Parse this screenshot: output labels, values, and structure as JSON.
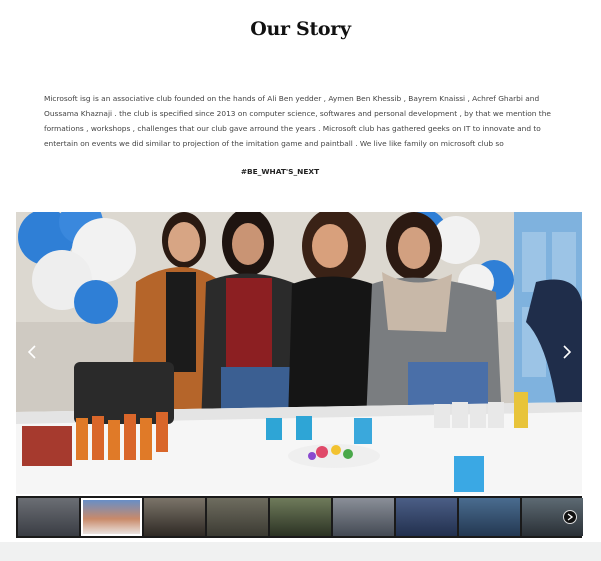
{
  "page": {
    "title": "Our Story",
    "story": "Microsoft isg is an associative club founded on the hands of Ali Ben yedder , Aymen Ben Khessib , Bayrem Knaissi , Achref Gharbi and Oussama Khaznaji . the club is specified since 2013 on computer science, softwares and personal development , by that we mention the formations , workshops , challenges that our club gave arround the years . Microsoft club has gathered geeks on IT to innovate and to entertain on events we did similar to projection of the imitation game and paintball . We live like family on microsoft club so",
    "hashtag": "#BE_WHAT'S_NEXT"
  },
  "gallery": {
    "prev_icon": "chevron-left-icon",
    "next_icon": "chevron-right-icon",
    "active_index": 1,
    "thumbnail_count": 9,
    "thumb_next_icon": "chevron-right-circle-icon"
  },
  "colors": {
    "balloon_blue": "#2f7fd6",
    "balloon_white": "#f2f2f2",
    "door_blue": "#7fb2de",
    "footer_band": "#f0f1f1"
  }
}
